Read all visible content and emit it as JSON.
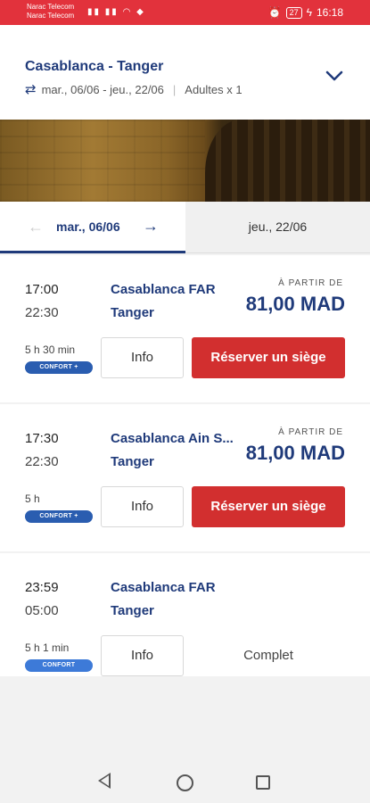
{
  "status_bar": {
    "carrier1": "Narac Telecom",
    "carrier2": "Narac Telecom",
    "battery": "27",
    "time": "16:18"
  },
  "header": {
    "route": "Casablanca - Tanger",
    "dates": "mar., 06/06 - jeu., 22/06",
    "passengers": "Adultes x 1"
  },
  "tabs": {
    "outbound": "mar., 06/06",
    "return": "jeu., 22/06"
  },
  "trips": [
    {
      "departure": "17:00",
      "arrival": "22:30",
      "from": "Casablanca FAR",
      "to": "Tanger",
      "price_label": "À PARTIR DE",
      "price": "81,00 MAD",
      "duration": "5 h 30 min",
      "badge": "CONFORT +",
      "info": "Info",
      "action": "Réserver un siège"
    },
    {
      "departure": "17:30",
      "arrival": "22:30",
      "from": "Casablanca Ain S...",
      "to": "Tanger",
      "price_label": "À PARTIR DE",
      "price": "81,00 MAD",
      "duration": "5 h",
      "badge": "CONFORT +",
      "info": "Info",
      "action": "Réserver un siège"
    },
    {
      "departure": "23:59",
      "arrival": "05:00",
      "from": "Casablanca FAR",
      "to": "Tanger",
      "duration": "5 h 1 min",
      "badge": "CONFORT",
      "info": "Info",
      "status": "Complet"
    }
  ],
  "colors": {
    "brand_red": "#e2323c",
    "navy": "#1f3a7a",
    "reserve_red": "#d22f2f",
    "badge_blue": "#2a5db0"
  }
}
